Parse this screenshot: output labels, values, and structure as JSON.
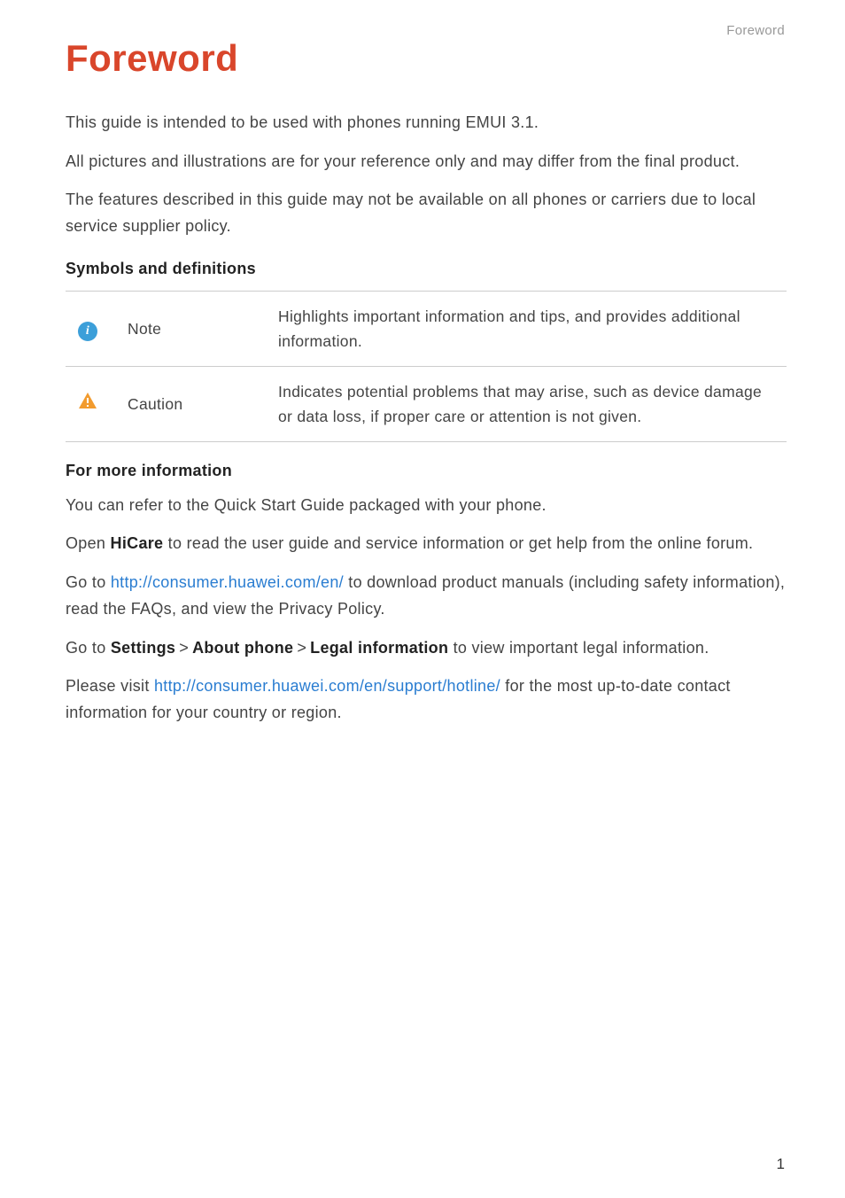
{
  "header": {
    "section_label": "Foreword"
  },
  "title": "Foreword",
  "intro": {
    "p1": "This guide is intended to be used with phones running EMUI 3.1.",
    "p2": "All pictures and illustrations are for your reference only and may differ from the final product.",
    "p3": "The features described in this guide may not be available on all phones or carriers due to local service supplier policy."
  },
  "symbols": {
    "heading": "Symbols and definitions",
    "rows": [
      {
        "icon": "i",
        "label": "Note",
        "desc": "Highlights important information and tips, and provides additional information."
      },
      {
        "icon": "caution",
        "label": "Caution",
        "desc": "Indicates potential problems that may arise, such as device damage or data loss, if proper care or attention is not given."
      }
    ]
  },
  "more_info": {
    "heading": "For more information",
    "p1": "You can refer to the Quick Start Guide packaged with your phone.",
    "p2_pre": "Open ",
    "p2_bold": "HiCare",
    "p2_post": " to read the user guide and service information or get help from the online forum.",
    "p3_pre": "Go to ",
    "p3_link": "http://consumer.huawei.com/en/",
    "p3_post": " to download product manuals (including safety information), read the FAQs, and view the Privacy Policy.",
    "p4_pre": "Go to ",
    "p4_b1": "Settings",
    "p4_sep": ">",
    "p4_b2": "About phone",
    "p4_b3": "Legal information",
    "p4_post": " to view important legal information.",
    "p5_pre": "Please visit ",
    "p5_link": "http://consumer.huawei.com/en/support/hotline/",
    "p5_post": " for the most up-to-date contact information for your country or region."
  },
  "page_number": "1"
}
